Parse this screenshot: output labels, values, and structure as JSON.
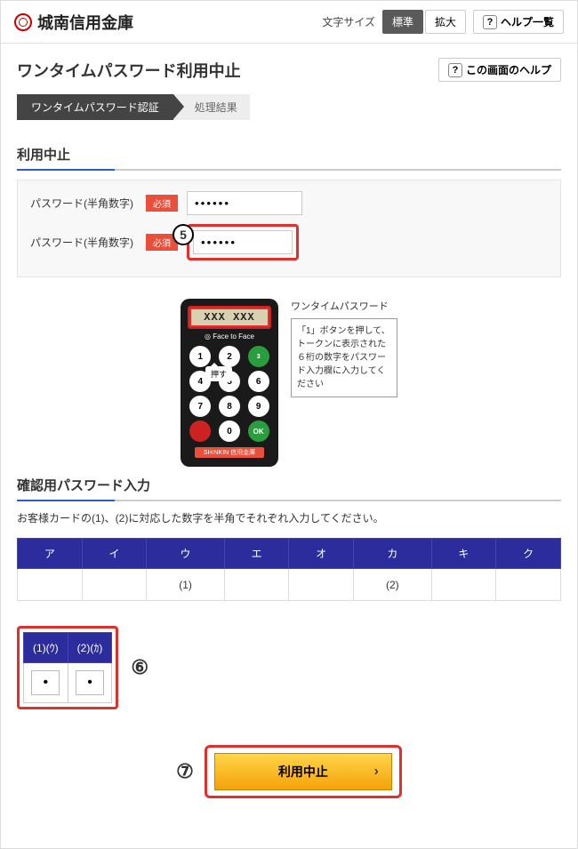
{
  "header": {
    "bank_name": "城南信用金庫",
    "font_size_label": "文字サイズ",
    "btn_standard": "標準",
    "btn_large": "拡大",
    "help_list": "ヘルプ一覧"
  },
  "page": {
    "title": "ワンタイムパスワード利用中止",
    "help_button": "この画面のヘルプ",
    "steps": {
      "active": "ワンタイムパスワード認証",
      "inactive": "処理結果"
    }
  },
  "section1": {
    "title": "利用中止",
    "row1_label": "パスワード(半角数字)",
    "row2_label": "パスワード(半角数字)",
    "required": "必須",
    "value1": "••••••",
    "value2": "••••••"
  },
  "annotations": {
    "step5": "5",
    "step6": "⑥",
    "step7": "⑦"
  },
  "token": {
    "display": "XXX XXX",
    "brand": "◎ Face to Face",
    "keys": [
      "1",
      "2",
      "3",
      "4",
      "5",
      "6",
      "7",
      "8",
      "9",
      "",
      "0",
      "OK"
    ],
    "balloon": "押す",
    "badge": "SHINKIN 信用金庫",
    "note_title": "ワンタイムパスワード",
    "note_body": "「1」ボタンを押して、トークンに表示された６桁の数字をパスワード入力欄に入力してください"
  },
  "section2": {
    "title": "確認用パスワード入力",
    "instruction": "お客様カードの(1)、(2)に対応した数字を半角でそれぞれ入力してください。",
    "kana_headers": [
      "ア",
      "イ",
      "ウ",
      "エ",
      "オ",
      "カ",
      "キ",
      "ク"
    ],
    "kana_cells": [
      "",
      "",
      "(1)",
      "",
      "",
      "(2)",
      "",
      ""
    ],
    "confirm_headers": [
      "(1)(ｳ)",
      "(2)(ｶ)"
    ],
    "confirm_values": [
      "•",
      "•"
    ]
  },
  "submit": {
    "label": "利用中止"
  }
}
